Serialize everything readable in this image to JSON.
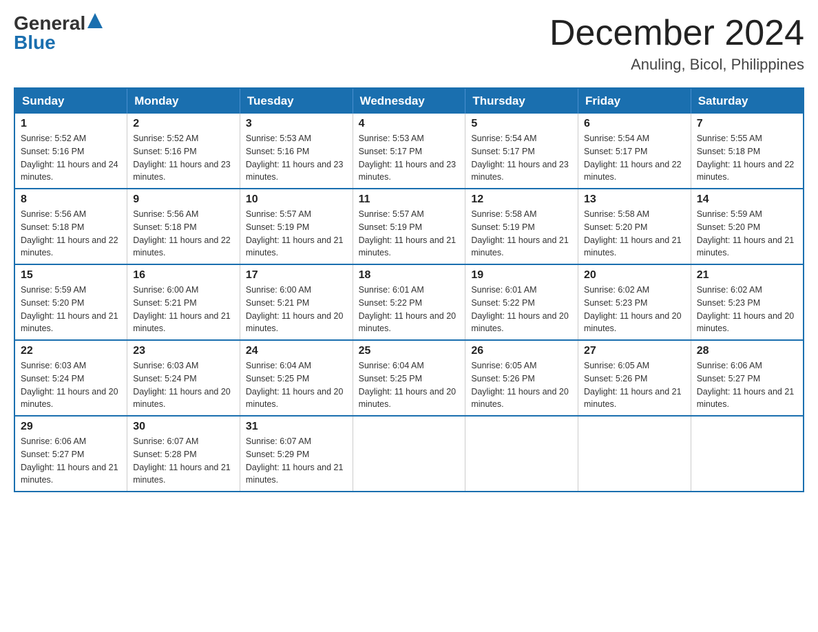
{
  "header": {
    "logo_general": "General",
    "logo_blue": "Blue",
    "month_year": "December 2024",
    "location": "Anuling, Bicol, Philippines"
  },
  "days_of_week": [
    "Sunday",
    "Monday",
    "Tuesday",
    "Wednesday",
    "Thursday",
    "Friday",
    "Saturday"
  ],
  "weeks": [
    [
      {
        "day": "1",
        "sunrise": "5:52 AM",
        "sunset": "5:16 PM",
        "daylight": "11 hours and 24 minutes."
      },
      {
        "day": "2",
        "sunrise": "5:52 AM",
        "sunset": "5:16 PM",
        "daylight": "11 hours and 23 minutes."
      },
      {
        "day": "3",
        "sunrise": "5:53 AM",
        "sunset": "5:16 PM",
        "daylight": "11 hours and 23 minutes."
      },
      {
        "day": "4",
        "sunrise": "5:53 AM",
        "sunset": "5:17 PM",
        "daylight": "11 hours and 23 minutes."
      },
      {
        "day": "5",
        "sunrise": "5:54 AM",
        "sunset": "5:17 PM",
        "daylight": "11 hours and 23 minutes."
      },
      {
        "day": "6",
        "sunrise": "5:54 AM",
        "sunset": "5:17 PM",
        "daylight": "11 hours and 22 minutes."
      },
      {
        "day": "7",
        "sunrise": "5:55 AM",
        "sunset": "5:18 PM",
        "daylight": "11 hours and 22 minutes."
      }
    ],
    [
      {
        "day": "8",
        "sunrise": "5:56 AM",
        "sunset": "5:18 PM",
        "daylight": "11 hours and 22 minutes."
      },
      {
        "day": "9",
        "sunrise": "5:56 AM",
        "sunset": "5:18 PM",
        "daylight": "11 hours and 22 minutes."
      },
      {
        "day": "10",
        "sunrise": "5:57 AM",
        "sunset": "5:19 PM",
        "daylight": "11 hours and 21 minutes."
      },
      {
        "day": "11",
        "sunrise": "5:57 AM",
        "sunset": "5:19 PM",
        "daylight": "11 hours and 21 minutes."
      },
      {
        "day": "12",
        "sunrise": "5:58 AM",
        "sunset": "5:19 PM",
        "daylight": "11 hours and 21 minutes."
      },
      {
        "day": "13",
        "sunrise": "5:58 AM",
        "sunset": "5:20 PM",
        "daylight": "11 hours and 21 minutes."
      },
      {
        "day": "14",
        "sunrise": "5:59 AM",
        "sunset": "5:20 PM",
        "daylight": "11 hours and 21 minutes."
      }
    ],
    [
      {
        "day": "15",
        "sunrise": "5:59 AM",
        "sunset": "5:20 PM",
        "daylight": "11 hours and 21 minutes."
      },
      {
        "day": "16",
        "sunrise": "6:00 AM",
        "sunset": "5:21 PM",
        "daylight": "11 hours and 21 minutes."
      },
      {
        "day": "17",
        "sunrise": "6:00 AM",
        "sunset": "5:21 PM",
        "daylight": "11 hours and 20 minutes."
      },
      {
        "day": "18",
        "sunrise": "6:01 AM",
        "sunset": "5:22 PM",
        "daylight": "11 hours and 20 minutes."
      },
      {
        "day": "19",
        "sunrise": "6:01 AM",
        "sunset": "5:22 PM",
        "daylight": "11 hours and 20 minutes."
      },
      {
        "day": "20",
        "sunrise": "6:02 AM",
        "sunset": "5:23 PM",
        "daylight": "11 hours and 20 minutes."
      },
      {
        "day": "21",
        "sunrise": "6:02 AM",
        "sunset": "5:23 PM",
        "daylight": "11 hours and 20 minutes."
      }
    ],
    [
      {
        "day": "22",
        "sunrise": "6:03 AM",
        "sunset": "5:24 PM",
        "daylight": "11 hours and 20 minutes."
      },
      {
        "day": "23",
        "sunrise": "6:03 AM",
        "sunset": "5:24 PM",
        "daylight": "11 hours and 20 minutes."
      },
      {
        "day": "24",
        "sunrise": "6:04 AM",
        "sunset": "5:25 PM",
        "daylight": "11 hours and 20 minutes."
      },
      {
        "day": "25",
        "sunrise": "6:04 AM",
        "sunset": "5:25 PM",
        "daylight": "11 hours and 20 minutes."
      },
      {
        "day": "26",
        "sunrise": "6:05 AM",
        "sunset": "5:26 PM",
        "daylight": "11 hours and 20 minutes."
      },
      {
        "day": "27",
        "sunrise": "6:05 AM",
        "sunset": "5:26 PM",
        "daylight": "11 hours and 21 minutes."
      },
      {
        "day": "28",
        "sunrise": "6:06 AM",
        "sunset": "5:27 PM",
        "daylight": "11 hours and 21 minutes."
      }
    ],
    [
      {
        "day": "29",
        "sunrise": "6:06 AM",
        "sunset": "5:27 PM",
        "daylight": "11 hours and 21 minutes."
      },
      {
        "day": "30",
        "sunrise": "6:07 AM",
        "sunset": "5:28 PM",
        "daylight": "11 hours and 21 minutes."
      },
      {
        "day": "31",
        "sunrise": "6:07 AM",
        "sunset": "5:29 PM",
        "daylight": "11 hours and 21 minutes."
      },
      null,
      null,
      null,
      null
    ]
  ]
}
